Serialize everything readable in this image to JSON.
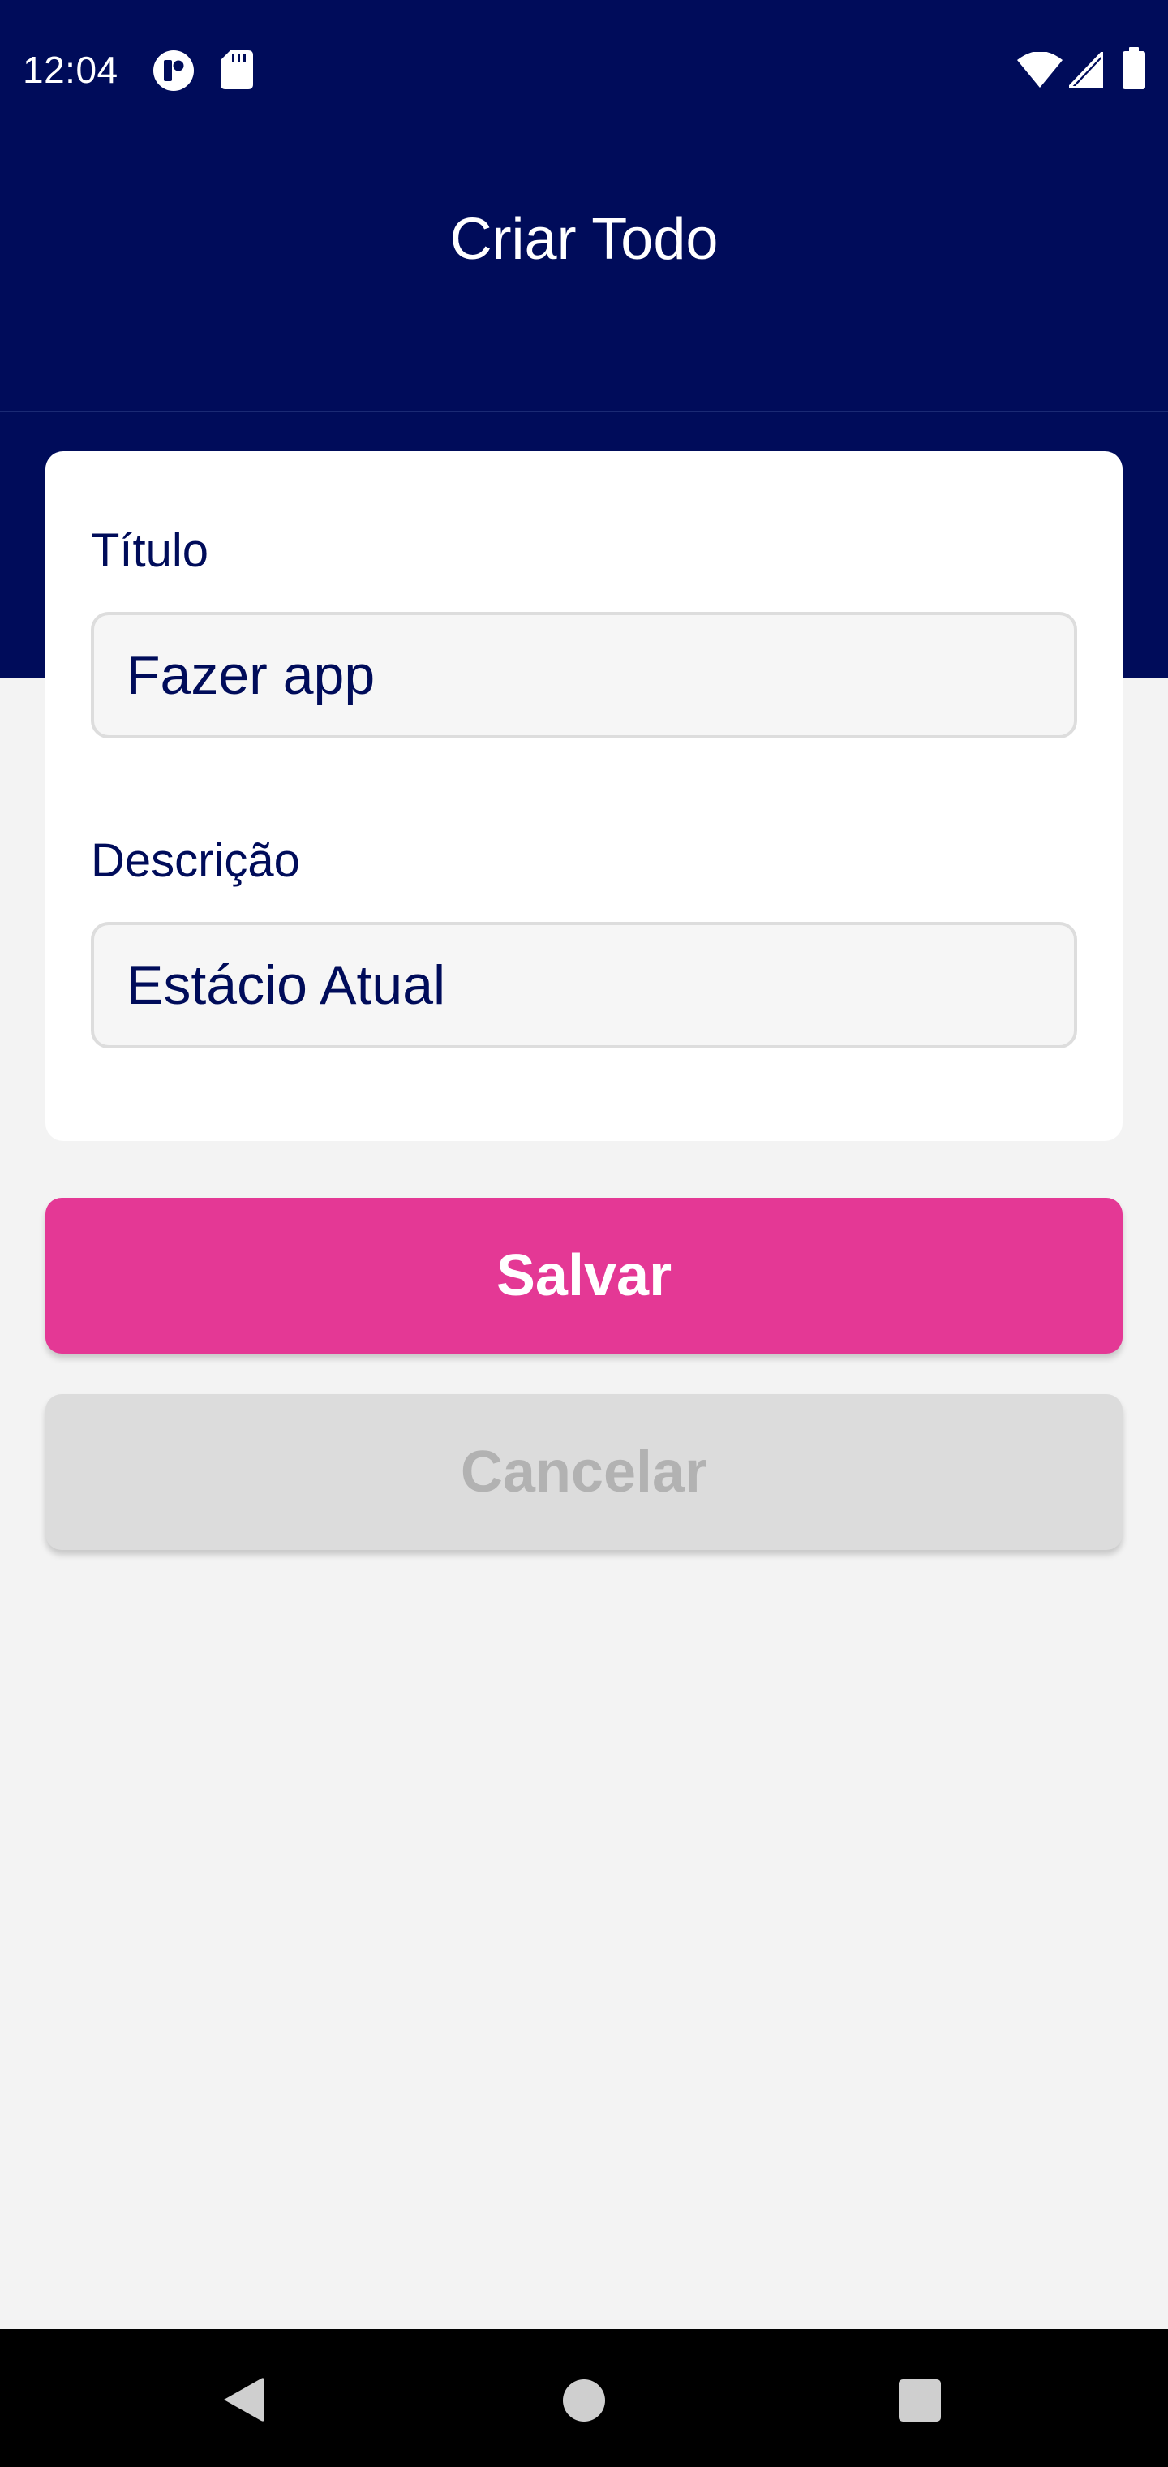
{
  "status_bar": {
    "time": "12:04",
    "icons": {
      "notification_1": "app-notification-icon",
      "notification_2": "sd-card-icon",
      "wifi": "wifi-icon",
      "cell": "cell-signal-icon",
      "battery": "battery-icon"
    }
  },
  "app_bar": {
    "title": "Criar Todo"
  },
  "form": {
    "title_label": "Título",
    "title_value": "Fazer app",
    "description_label": "Descrição",
    "description_value": "Estácio Atual"
  },
  "actions": {
    "save_label": "Salvar",
    "cancel_label": "Cancelar"
  },
  "nav_bar": {
    "back": "back-icon",
    "home": "home-icon",
    "recents": "recents-icon"
  },
  "colors": {
    "header": "#000c5a",
    "accent": "#e43895",
    "background": "#f3f3f3",
    "cancel": "#dcdcdc"
  }
}
